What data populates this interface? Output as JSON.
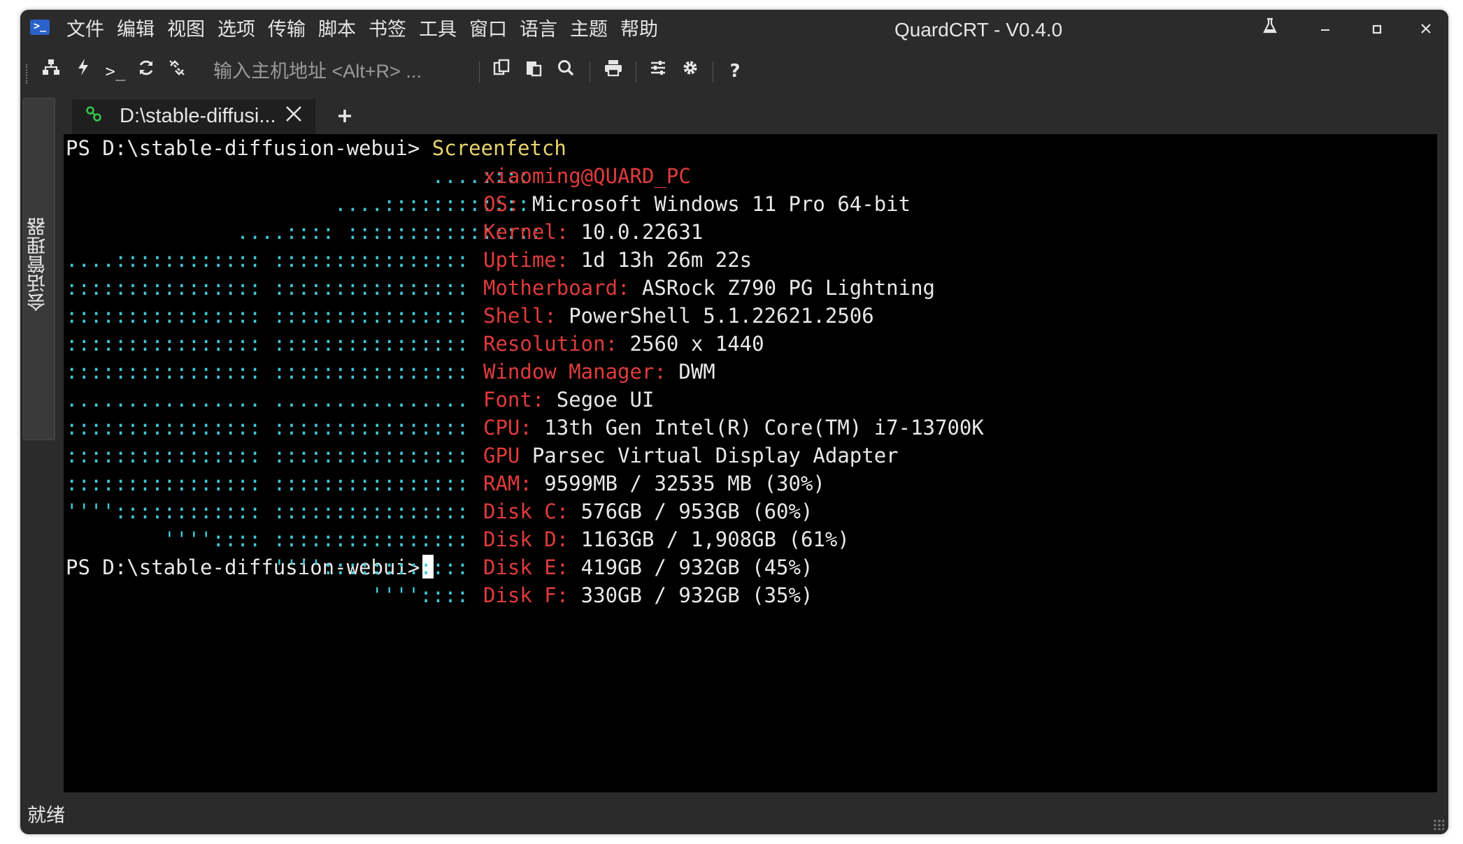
{
  "window": {
    "title": "QuardCRT - V0.4.0",
    "menu": [
      "文件",
      "编辑",
      "视图",
      "选项",
      "传输",
      "脚本",
      "书签",
      "工具",
      "窗口",
      "语言",
      "主题",
      "帮助"
    ]
  },
  "toolbar": {
    "address_placeholder": "输入主机地址 <Alt+R> ..."
  },
  "sidebar": {
    "label": "会话管理器"
  },
  "tabs": [
    {
      "label": "D:\\stable-diffusi..."
    }
  ],
  "terminal": {
    "prompt_cmd": {
      "prompt": "PS D:\\stable-diffusion-webui> ",
      "command": "Screenfetch"
    },
    "logo_lines": [
      "                              ....::::",
      "                      ....::::::::::::",
      "              ....:::: ::::::::::::::::",
      "....:::::::::::: ::::::::::::::::",
      ":::::::::::::::: ::::::::::::::::",
      ":::::::::::::::: ::::::::::::::::",
      ":::::::::::::::: ::::::::::::::::",
      ":::::::::::::::: ::::::::::::::::",
      "................ ................",
      ":::::::::::::::: ::::::::::::::::",
      ":::::::::::::::: ::::::::::::::::",
      ":::::::::::::::: ::::::::::::::::",
      "'''':::::::::::: ::::::::::::::::",
      "        '''':::: ::::::::::::::::",
      "                 ''''::::::::::::",
      "                         ''''::::"
    ],
    "info": [
      {
        "key": "xiaoming@QUARD_PC",
        "value": ""
      },
      {
        "key": "OS:",
        "value": " Microsoft Windows 11 Pro 64-bit"
      },
      {
        "key": "Kernel:",
        "value": " 10.0.22631"
      },
      {
        "key": "Uptime:",
        "value": " 1d 13h 26m 22s"
      },
      {
        "key": "Motherboard:",
        "value": " ASRock Z790 PG Lightning"
      },
      {
        "key": "Shell:",
        "value": " PowerShell 5.1.22621.2506"
      },
      {
        "key": "Resolution:",
        "value": " 2560 x 1440"
      },
      {
        "key": "Window Manager:",
        "value": " DWM"
      },
      {
        "key": "Font:",
        "value": " Segoe UI"
      },
      {
        "key": "CPU:",
        "value": " 13th Gen Intel(R) Core(TM) i7-13700K"
      },
      {
        "key": "GPU",
        "value": " Parsec Virtual Display Adapter"
      },
      {
        "key": "RAM:",
        "value": " 9599MB / 32535 MB (30%)"
      },
      {
        "key": "Disk C:",
        "value": " 576GB / 953GB (60%)"
      },
      {
        "key": "Disk D:",
        "value": " 1163GB / 1,908GB (61%)"
      },
      {
        "key": "Disk E:",
        "value": " 419GB / 932GB (45%)"
      },
      {
        "key": "Disk F:",
        "value": " 330GB / 932GB (35%)"
      }
    ],
    "final_prompt": "PS D:\\stable-diffusion-webui>"
  },
  "status": {
    "text": "就绪"
  },
  "colors": {
    "logo": "#3fc8d8",
    "info_key": "#e03b3b",
    "command": "#e8d36e",
    "tab_accent": "#3a8ee6"
  }
}
